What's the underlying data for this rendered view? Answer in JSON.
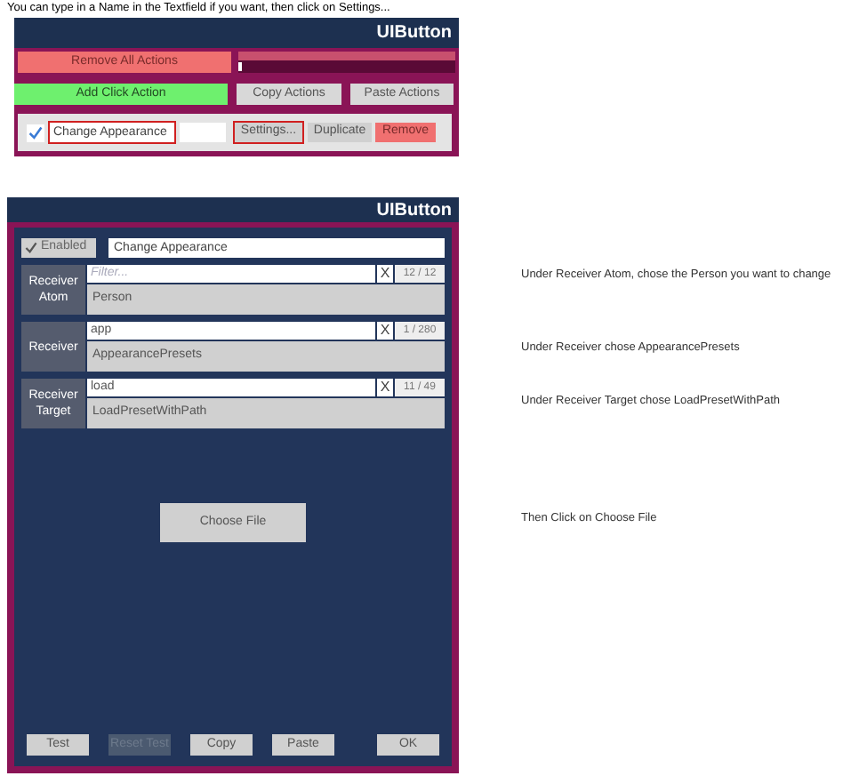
{
  "instruction": "You can type in a Name in the Textfield if you want, then click on Settings...",
  "top_panel": {
    "title": "UIButton",
    "remove_all": "Remove All Actions",
    "slider": {
      "level": 0
    },
    "add_click": "Add Click Action",
    "copy_actions": "Copy Actions",
    "paste_actions": "Paste Actions",
    "action": {
      "checked": true,
      "name": {
        "value": "Change Appearance",
        "highlighted": true
      },
      "settings": {
        "label": "Settings...",
        "highlighted": true
      },
      "duplicate": "Duplicate",
      "remove": "Remove"
    }
  },
  "settings_panel": {
    "title": "UIButton",
    "enabled": {
      "label": "Enabled",
      "checked": true
    },
    "name": "Change Appearance",
    "receivers": [
      {
        "label": "Receiver Atom",
        "filter_placeholder": "Filter...",
        "clear": "X",
        "count": "12 / 12",
        "value": "Person"
      },
      {
        "label": "Receiver",
        "filter": "app",
        "clear": "X",
        "count": "1 / 280",
        "value": "AppearancePresets"
      },
      {
        "label": "Receiver Target",
        "filter": "load",
        "clear": "X",
        "count": "11 / 49",
        "value": "LoadPresetWithPath"
      }
    ],
    "choose_file": "Choose File",
    "buttons": [
      {
        "label": "Test",
        "disabled": false
      },
      {
        "label": "Reset Test",
        "disabled": true
      },
      {
        "label": "Copy",
        "disabled": false
      },
      {
        "label": "Paste",
        "disabled": false
      }
    ],
    "ok": "OK"
  },
  "notes": [
    "Under Receiver Atom, chose the Person you want to change",
    "Under Receiver chose AppearancePresets",
    "Under Receiver Target chose LoadPresetWithPath",
    "Then Click on Choose File"
  ]
}
